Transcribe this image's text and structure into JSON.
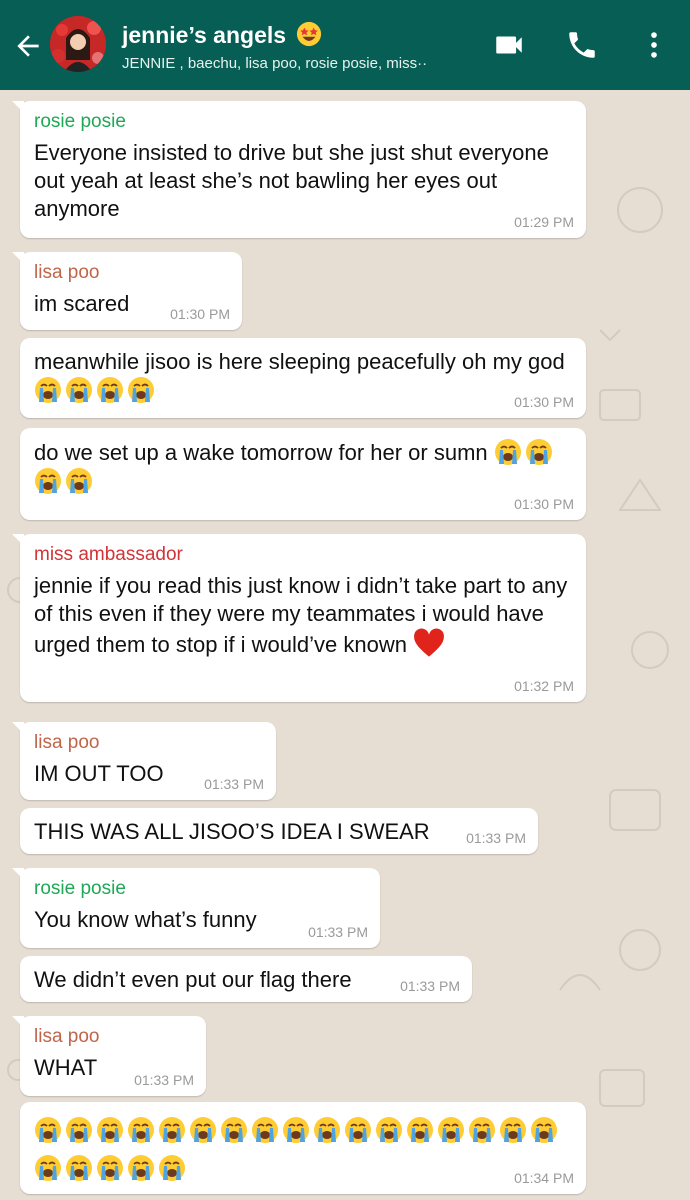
{
  "header": {
    "title": "jennie’s angels",
    "title_emoji": "star-struck-emoji",
    "subtitle": "JENNIE , baechu, lisa poo, rosie posie, miss··",
    "icons": [
      "back-arrow-icon",
      "video-call-icon",
      "phone-icon",
      "more-options-icon"
    ],
    "color": "#075e54"
  },
  "messages": [
    {
      "sender": "rosie posie",
      "sender_color": "#1fa855",
      "text": "Everyone insisted to drive but she just shut everyone out yeah at least she’s not bawling her eyes out anymore",
      "time": "01:29 PM"
    },
    {
      "sender": "lisa poo",
      "sender_color": "#c0654a",
      "text": "im scared",
      "time": "01:30 PM"
    },
    {
      "text": "meanwhile jisoo is here sleeping peacefully oh my god",
      "emoji_count": 4,
      "time": "01:30 PM"
    },
    {
      "text": "do we set up a wake tomorrow for her or sumn",
      "emoji_count": 4,
      "time": "01:30 PM"
    },
    {
      "sender": "miss ambassador",
      "sender_color": "#d13438",
      "text": "jennie if you read this just know i didn’t take part to any of this even if they were my teammates i would have urged them to stop if i would’ve known",
      "emoji": "red-heart-emoji",
      "time": "01:32 PM"
    },
    {
      "sender": "lisa poo",
      "sender_color": "#c0654a",
      "text": "IM OUT TOO",
      "time": "01:33 PM"
    },
    {
      "text": "THIS WAS ALL JISOO’S IDEA I SWEAR",
      "time": "01:33 PM"
    },
    {
      "sender": "rosie posie",
      "sender_color": "#1fa855",
      "text": "You know what’s funny",
      "time": "01:33 PM"
    },
    {
      "text": "We didn’t even put our flag there",
      "time": "01:33 PM"
    },
    {
      "sender": "lisa poo",
      "sender_color": "#c0654a",
      "text": "WHAT",
      "time": "01:33 PM"
    },
    {
      "text": "",
      "emoji_count": 22,
      "time": "01:34 PM"
    }
  ],
  "emoji_name": "loudly-crying-face-emoji"
}
